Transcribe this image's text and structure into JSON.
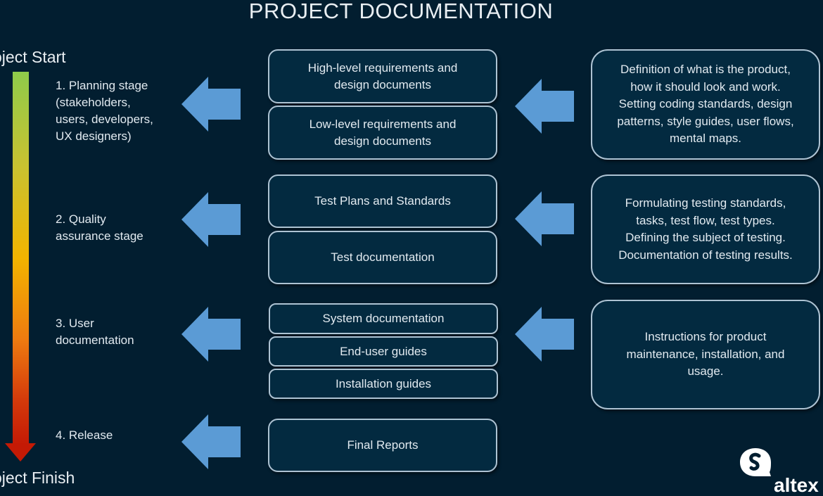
{
  "title": "PROJECT DOCUMENTATION",
  "timeline": {
    "start_label": "Project Start",
    "finish_label": "Project Finish",
    "gradient_colors": [
      "#8fcb4a",
      "#f2b400",
      "#c41a05"
    ]
  },
  "stages": [
    {
      "label": "1. Planning stage\n(stakeholders,\nusers, developers,\nUX designers)"
    },
    {
      "label": "2. Quality\nassurance stage"
    },
    {
      "label": "3. User\ndocumentation"
    },
    {
      "label": "4. Release"
    }
  ],
  "documents": [
    {
      "label": "High-level requirements and\ndesign documents"
    },
    {
      "label": "Low-level requirements and\ndesign documents"
    },
    {
      "label": "Test Plans and Standards"
    },
    {
      "label": "Test documentation"
    },
    {
      "label": "System documentation"
    },
    {
      "label": "End-user guides"
    },
    {
      "label": "Installation guides"
    },
    {
      "label": "Final Reports"
    }
  ],
  "descriptions": [
    {
      "text": "Definition of what is the product,\nhow it should look and work.\nSetting coding standards, design\npatterns, style guides, user flows,\nmental maps."
    },
    {
      "text": "Formulating testing standards,\ntasks, test flow, test types.\nDefining the subject of testing.\nDocumentation of testing results."
    },
    {
      "text": "Instructions for product\nmaintenance, installation, and\nusage."
    }
  ],
  "colors": {
    "background": "#021e30",
    "arrow": "#5b9bd5",
    "box_border": "#aec3d3"
  },
  "logo": {
    "icon": "altexsoft-logo-icon",
    "text": "altex"
  }
}
